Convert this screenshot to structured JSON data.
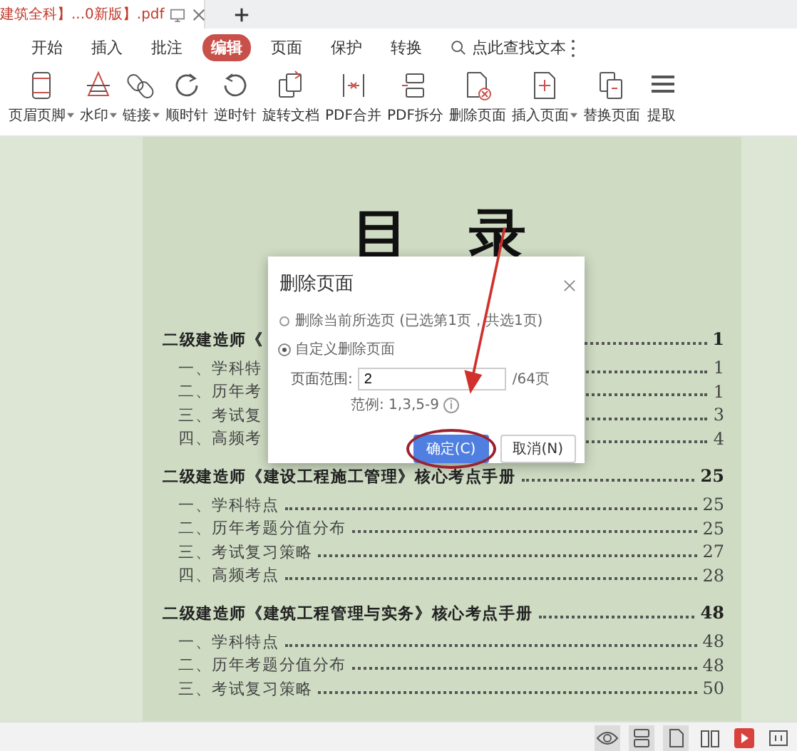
{
  "tab": {
    "title": "建筑全科】...0新版】.pdf"
  },
  "menu": [
    {
      "label": "开始",
      "selected": false
    },
    {
      "label": "插入",
      "selected": false
    },
    {
      "label": "批注",
      "selected": false
    },
    {
      "label": "编辑",
      "selected": true
    },
    {
      "label": "页面",
      "selected": false
    },
    {
      "label": "保护",
      "selected": false
    },
    {
      "label": "转换",
      "selected": false
    }
  ],
  "search": {
    "placeholder": "点此查找文本"
  },
  "toolbar": [
    {
      "kind": "header",
      "label": "页眉页脚",
      "dropdown": true
    },
    {
      "kind": "watermark",
      "label": "水印",
      "dropdown": true
    },
    {
      "kind": "link",
      "label": "链接",
      "dropdown": true
    },
    {
      "kind": "cw",
      "label": "顺时针",
      "dropdown": false
    },
    {
      "kind": "ccw",
      "label": "逆时针",
      "dropdown": false
    },
    {
      "kind": "rotate",
      "label": "旋转文档",
      "dropdown": false
    },
    {
      "kind": "merge",
      "label": "PDF合并",
      "dropdown": false
    },
    {
      "kind": "split",
      "label": "PDF拆分",
      "dropdown": false
    },
    {
      "kind": "delete",
      "label": "删除页面",
      "dropdown": false
    },
    {
      "kind": "insert",
      "label": "插入页面",
      "dropdown": true
    },
    {
      "kind": "replace",
      "label": "替换页面",
      "dropdown": false
    },
    {
      "kind": "extract",
      "label": "提取",
      "dropdown": false
    }
  ],
  "document": {
    "title": "目 录",
    "toc": [
      {
        "text": "二级建造师《",
        "page": "1",
        "children": [
          {
            "text": "一、学科特",
            "page": "1"
          },
          {
            "text": "二、历年考",
            "page": "1"
          },
          {
            "text": "三、考试复",
            "page": "3"
          },
          {
            "text": "四、高频考",
            "page": "4"
          }
        ]
      },
      {
        "text": "二级建造师《建设工程施工管理》核心考点手册",
        "page": "25",
        "children": [
          {
            "text": "一、学科特点",
            "page": "25"
          },
          {
            "text": "二、历年考题分值分布",
            "page": "25"
          },
          {
            "text": "三、考试复习策略",
            "page": "27"
          },
          {
            "text": "四、高频考点",
            "page": "28"
          }
        ]
      },
      {
        "text": "二级建造师《建筑工程管理与实务》核心考点手册",
        "page": "48",
        "children": [
          {
            "text": "一、学科特点",
            "page": "48"
          },
          {
            "text": "二、历年考题分值分布",
            "page": "48"
          },
          {
            "text": "三、考试复习策略",
            "page": "50"
          }
        ]
      }
    ]
  },
  "dialog": {
    "title": "删除页面",
    "options": [
      {
        "label": "删除当前所选页 (已选第1页，共选1页)",
        "selected": false
      },
      {
        "label": "自定义删除页面",
        "selected": true
      }
    ],
    "range_label": "页面范围:",
    "range_value": "2",
    "range_suffix": "/64页",
    "hint": "范例: 1,3,5-9",
    "info": "i",
    "buttons": [
      {
        "label": "确定(C)",
        "kind": "primary"
      },
      {
        "label": "取消(N)",
        "kind": "secondary"
      }
    ]
  }
}
